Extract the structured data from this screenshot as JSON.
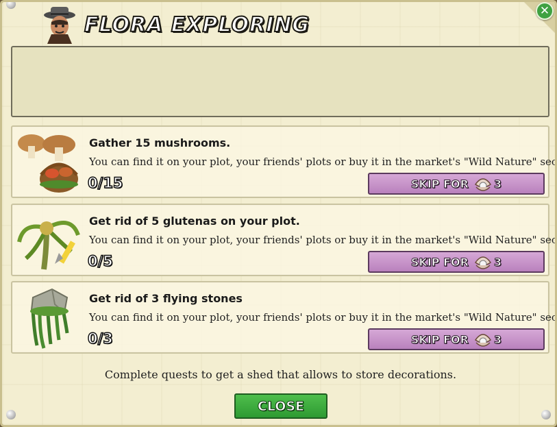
{
  "dialog": {
    "title": "Flora exploring",
    "close_icon_glyph": "✕",
    "description": "Complete quests to get a shed that allows to store decorations.",
    "close_button_label": "CLOSE"
  },
  "quests": [
    {
      "title": "Gather 15 mushrooms.",
      "description": "You can find it on your plot, your friends' plots or buy it in the market's \"Wild Nature\" section",
      "progress": "0/15",
      "skip_label": "SKIP FOR",
      "skip_cost": "3",
      "icon": "mushroom-basket-icon"
    },
    {
      "title": "Get rid of 5 glutenas on your plot.",
      "description": "You can find it on your plot, your friends' plots or buy it in the market's \"Wild Nature\" section",
      "progress": "0/5",
      "skip_label": "SKIP FOR",
      "skip_cost": "3",
      "icon": "gluten-plant-icon"
    },
    {
      "title": "Get rid of 3 flying stones",
      "description": "You can find it on your plot, your friends' plots or buy it in the market's \"Wild Nature\" section",
      "progress": "0/3",
      "skip_label": "SKIP FOR",
      "skip_cost": "3",
      "icon": "flying-stone-icon"
    }
  ],
  "colors": {
    "skip_button": "#c393c6",
    "close_button": "#3ba93c",
    "parchment": "#f3eed1"
  }
}
